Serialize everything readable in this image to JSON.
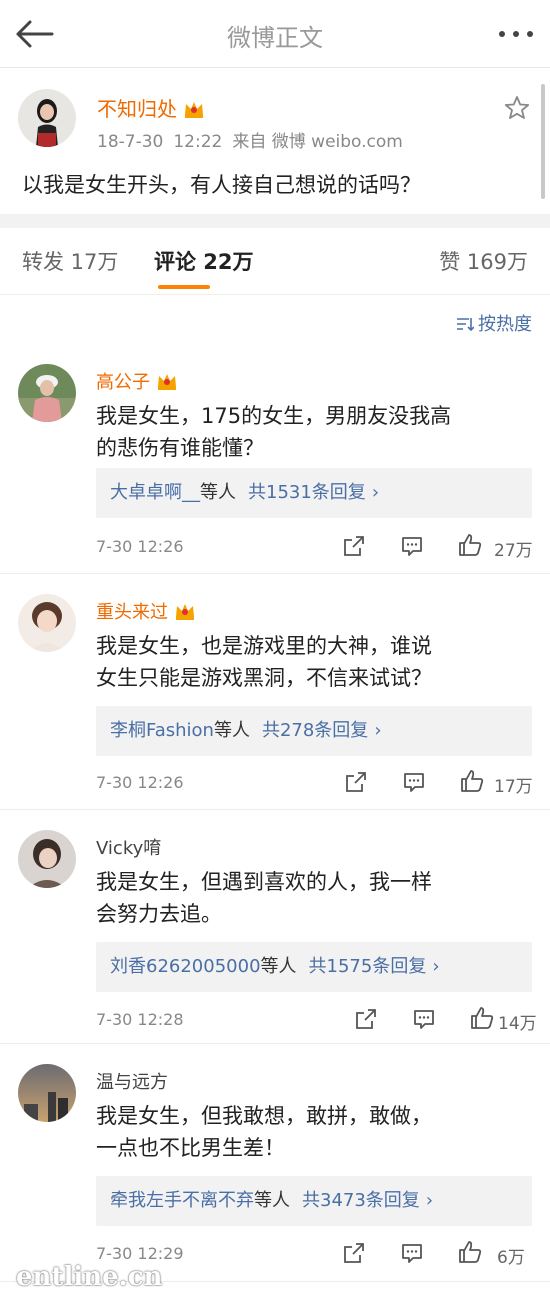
{
  "header": {
    "title": "微博正文"
  },
  "post": {
    "author": "不知归处",
    "date": "18-7-30",
    "time": "12:22",
    "source": "来自 微博 weibo.com",
    "text": "以我是女生开头，有人接自己想说的话吗？"
  },
  "tabs": {
    "repost": "转发 17万",
    "comment": "评论 22万",
    "like": "赞 169万"
  },
  "sort_label": "按热度",
  "comments": [
    {
      "name": "高公子",
      "line1": "我是女生，175的女生，男朋友没我高",
      "line2": "的悲伤有谁能懂？",
      "reply_who": "大卓卓啊__",
      "reply_mid": "等人",
      "reply_count": "共1531条回复",
      "time": "7-30 12:26",
      "likes": "27万"
    },
    {
      "name": "重头来过",
      "line1": "我是女生，也是游戏里的大神，谁说",
      "line2": "女生只能是游戏黑洞，不信来试试？",
      "reply_who": "李桐Fashion",
      "reply_mid": "等人",
      "reply_count": "共278条回复",
      "time": "7-30 12:26",
      "likes": "17万"
    },
    {
      "name": "Vicky唷",
      "line1": "我是女生，但遇到喜欢的人，我一样",
      "line2": "会努力去追。",
      "reply_who": "刘香6262005000",
      "reply_mid": "等人",
      "reply_count": "共1575条回复",
      "time": "7-30 12:28",
      "likes": "14万"
    },
    {
      "name": "温与远方",
      "line1": "我是女生，但我敢想，敢拼，敢做，",
      "line2": "一点也不比男生差！",
      "reply_who": "牵我左手不离不弃",
      "reply_mid": "等人",
      "reply_count": "共3473条回复",
      "time": "7-30 12:29",
      "likes": "6万"
    }
  ],
  "reply_chevron": "›",
  "watermark": "entline.cn",
  "icons": [
    "back-arrow-icon",
    "more-dots-icon",
    "crown-icon",
    "star-icon",
    "sort-icon",
    "share-icon",
    "comment-icon",
    "like-icon"
  ],
  "colors": {
    "accent": "#ff8200",
    "vip_name": "#f06a00",
    "link": "#4a6fa5"
  }
}
